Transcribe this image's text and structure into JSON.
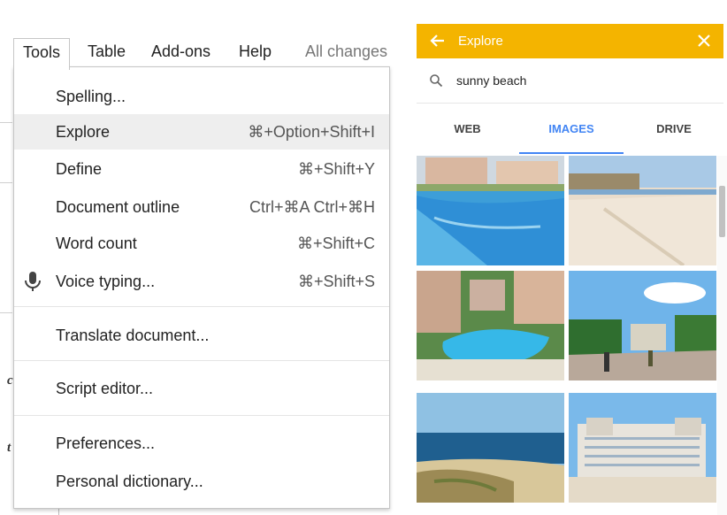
{
  "menubar": {
    "items": [
      {
        "label": "Tools",
        "active": true
      },
      {
        "label": "Table"
      },
      {
        "label": "Add-ons"
      },
      {
        "label": "Help"
      }
    ],
    "status": "All changes"
  },
  "tools_menu": {
    "items": [
      {
        "label": "Spelling...",
        "shortcut": ""
      },
      {
        "label": "Explore",
        "shortcut": "⌘+Option+Shift+I",
        "highlighted": true
      },
      {
        "label": "Define",
        "shortcut": "⌘+Shift+Y"
      },
      {
        "label": "Document outline",
        "shortcut": "Ctrl+⌘A Ctrl+⌘H"
      },
      {
        "label": "Word count",
        "shortcut": "⌘+Shift+C"
      },
      {
        "label": "Voice typing...",
        "shortcut": "⌘+Shift+S",
        "icon": "microphone-icon"
      },
      {
        "label": "Translate document...",
        "shortcut": ""
      },
      {
        "label": "Script editor...",
        "shortcut": ""
      },
      {
        "label": "Preferences...",
        "shortcut": ""
      },
      {
        "label": "Personal dictionary...",
        "shortcut": ""
      }
    ]
  },
  "explore": {
    "title": "Explore",
    "header_color": "#f4b400",
    "search_value": "sunny beach",
    "tabs": [
      {
        "label": "WEB"
      },
      {
        "label": "IMAGES",
        "active": true
      },
      {
        "label": "DRIVE"
      }
    ],
    "accent": "#4285f4",
    "images": [
      {
        "name": "resort-pool-image"
      },
      {
        "name": "sandy-beach-image"
      },
      {
        "name": "hotel-pool-aerial-image"
      },
      {
        "name": "promenade-image"
      },
      {
        "name": "sea-dunes-image"
      },
      {
        "name": "beach-hotel-image"
      }
    ]
  }
}
